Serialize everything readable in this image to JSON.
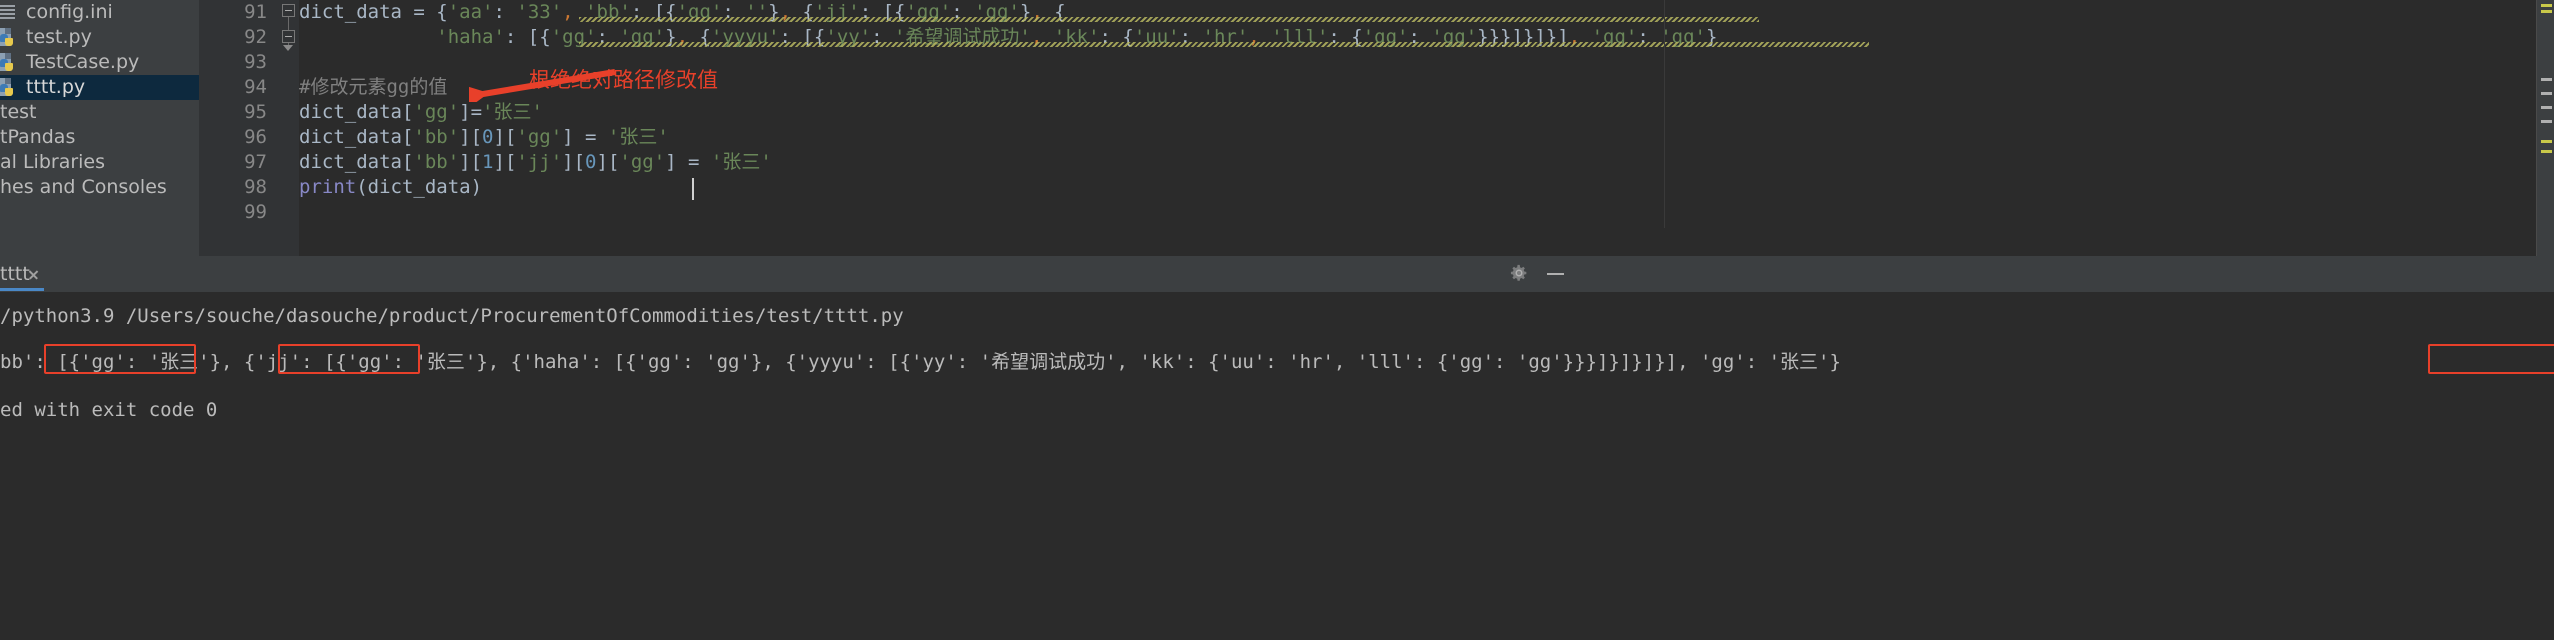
{
  "window": {
    "theme": "darcula"
  },
  "sidebar": {
    "items": [
      {
        "label": "config.ini",
        "icon": "ini-file-icon",
        "selected": false
      },
      {
        "label": "test.py",
        "icon": "python-file-icon",
        "selected": false
      },
      {
        "label": "TestCase.py",
        "icon": "python-file-icon",
        "selected": false
      },
      {
        "label": "tttt.py",
        "icon": "python-file-icon",
        "selected": true
      },
      {
        "label": "test",
        "icon": "none",
        "selected": false
      },
      {
        "label": "tPandas",
        "icon": "none",
        "selected": false
      },
      {
        "label": "al Libraries",
        "icon": "none",
        "selected": false
      },
      {
        "label": "hes and Consoles",
        "icon": "none",
        "selected": false
      }
    ]
  },
  "editor": {
    "line_numbers": [
      "91",
      "92",
      "93",
      "94",
      "95",
      "96",
      "97",
      "98",
      "99"
    ],
    "lines": [
      {
        "n": "91",
        "segments": [
          {
            "t": "dict_data = ",
            "c": "tok-def"
          },
          {
            "t": "{",
            "c": "tok-punct"
          },
          {
            "t": "'aa'",
            "c": "tok-str"
          },
          {
            "t": ": ",
            "c": "tok-punct"
          },
          {
            "t": "'33'",
            "c": "tok-str"
          },
          {
            "t": ",",
            "c": "tok-comma"
          },
          {
            "t": " ",
            "c": "tok-def"
          },
          {
            "t": "'bb'",
            "c": "tok-str"
          },
          {
            "t": ": [{",
            "c": "tok-punct"
          },
          {
            "t": "'gg'",
            "c": "tok-str"
          },
          {
            "t": ": ",
            "c": "tok-punct"
          },
          {
            "t": "''",
            "c": "tok-str"
          },
          {
            "t": "}",
            "c": "tok-punct"
          },
          {
            "t": ",",
            "c": "tok-comma"
          },
          {
            "t": " {",
            "c": "tok-punct"
          },
          {
            "t": "'jj'",
            "c": "tok-str"
          },
          {
            "t": ": [{",
            "c": "tok-punct"
          },
          {
            "t": "'gg'",
            "c": "tok-str"
          },
          {
            "t": ": ",
            "c": "tok-punct"
          },
          {
            "t": "'gg'",
            "c": "tok-str"
          },
          {
            "t": "}",
            "c": "tok-punct"
          },
          {
            "t": ",",
            "c": "tok-comma"
          },
          {
            "t": " {",
            "c": "tok-punct"
          }
        ]
      },
      {
        "n": "92",
        "segments": [
          {
            "t": "            ",
            "c": "tok-def"
          },
          {
            "t": "'haha'",
            "c": "tok-str"
          },
          {
            "t": ": [{",
            "c": "tok-punct"
          },
          {
            "t": "'gg'",
            "c": "tok-str"
          },
          {
            "t": ": ",
            "c": "tok-punct"
          },
          {
            "t": "'gg'",
            "c": "tok-str"
          },
          {
            "t": "}",
            "c": "tok-punct"
          },
          {
            "t": ",",
            "c": "tok-comma"
          },
          {
            "t": " {",
            "c": "tok-punct"
          },
          {
            "t": "'yyyu'",
            "c": "tok-str"
          },
          {
            "t": ": [{",
            "c": "tok-punct"
          },
          {
            "t": "'yy'",
            "c": "tok-str"
          },
          {
            "t": ": ",
            "c": "tok-punct"
          },
          {
            "t": "'希望调试成功'",
            "c": "tok-str"
          },
          {
            "t": ",",
            "c": "tok-comma"
          },
          {
            "t": " ",
            "c": "tok-def"
          },
          {
            "t": "'kk'",
            "c": "tok-str"
          },
          {
            "t": ": {",
            "c": "tok-punct"
          },
          {
            "t": "'uu'",
            "c": "tok-str"
          },
          {
            "t": ": ",
            "c": "tok-punct"
          },
          {
            "t": "'hr'",
            "c": "tok-str"
          },
          {
            "t": ",",
            "c": "tok-comma"
          },
          {
            "t": " ",
            "c": "tok-def"
          },
          {
            "t": "'lll'",
            "c": "tok-str"
          },
          {
            "t": ": {",
            "c": "tok-punct"
          },
          {
            "t": "'gg'",
            "c": "tok-str"
          },
          {
            "t": ": ",
            "c": "tok-punct"
          },
          {
            "t": "'gg'",
            "c": "tok-str"
          },
          {
            "t": "}}}]}]}]",
            "c": "tok-punct"
          },
          {
            "t": ",",
            "c": "tok-comma"
          },
          {
            "t": " ",
            "c": "tok-def"
          },
          {
            "t": "'gg'",
            "c": "tok-str"
          },
          {
            "t": ": ",
            "c": "tok-punct"
          },
          {
            "t": "'gg'",
            "c": "tok-str"
          },
          {
            "t": "}",
            "c": "tok-punct"
          }
        ]
      },
      {
        "n": "93",
        "segments": []
      },
      {
        "n": "94",
        "segments": [
          {
            "t": "#修改元素gg的值",
            "c": "tok-cmt"
          }
        ]
      },
      {
        "n": "95",
        "segments": [
          {
            "t": "dict_data[",
            "c": "tok-def"
          },
          {
            "t": "'gg'",
            "c": "tok-str"
          },
          {
            "t": "]=",
            "c": "tok-def"
          },
          {
            "t": "'张三'",
            "c": "tok-str"
          }
        ]
      },
      {
        "n": "96",
        "segments": [
          {
            "t": "dict_data[",
            "c": "tok-def"
          },
          {
            "t": "'bb'",
            "c": "tok-str"
          },
          {
            "t": "][",
            "c": "tok-def"
          },
          {
            "t": "0",
            "c": "tok-num"
          },
          {
            "t": "][",
            "c": "tok-def"
          },
          {
            "t": "'gg'",
            "c": "tok-str"
          },
          {
            "t": "] = ",
            "c": "tok-def"
          },
          {
            "t": "'张三'",
            "c": "tok-str"
          }
        ]
      },
      {
        "n": "97",
        "segments": [
          {
            "t": "dict_data[",
            "c": "tok-def"
          },
          {
            "t": "'bb'",
            "c": "tok-str"
          },
          {
            "t": "][",
            "c": "tok-def"
          },
          {
            "t": "1",
            "c": "tok-num"
          },
          {
            "t": "][",
            "c": "tok-def"
          },
          {
            "t": "'jj'",
            "c": "tok-str"
          },
          {
            "t": "][",
            "c": "tok-def"
          },
          {
            "t": "0",
            "c": "tok-num"
          },
          {
            "t": "][",
            "c": "tok-def"
          },
          {
            "t": "'gg'",
            "c": "tok-str"
          },
          {
            "t": "] = ",
            "c": "tok-def"
          },
          {
            "t": "'张三'",
            "c": "tok-str"
          }
        ]
      },
      {
        "n": "98",
        "segments": [
          {
            "t": "print",
            "c": "tok-fn"
          },
          {
            "t": "(dict_data)",
            "c": "tok-def"
          }
        ]
      },
      {
        "n": "99",
        "segments": []
      }
    ],
    "annotation": {
      "text": "根绝绝对路径修改值",
      "color": "#e8402a",
      "arrow": "red-arrow-pointing-left"
    }
  },
  "run_window": {
    "tab_label": "tttt",
    "close_icon": "close-icon",
    "settings_icon": "gear-icon",
    "minimize_icon": "minimize-icon",
    "console_lines": [
      "/python3.9 /Users/souche/dasouche/product/ProcurementOfCommodities/test/tttt.py",
      "bb': [{'gg': '张三'}, {'jj': [{'gg': '张三'}, {'haha': [{'gg': 'gg'}, {'yyyu': [{'yy': '希望调试成功', 'kk': {'uu': 'hr', 'lll': {'gg': 'gg'}}}]}]}]}], 'gg': '张三'}",
      "ed with exit code 0"
    ],
    "highlight_color": "#e8402a",
    "highlights": [
      "{'gg': '张三'}",
      "{'gg': '张三'}",
      "'gg': '张三'"
    ]
  },
  "colors": {
    "editor_bg": "#2b2b2b",
    "panel_bg": "#3c3f41",
    "gutter_bg": "#313335",
    "selection_bg": "#0d293e",
    "string": "#6a8759",
    "number": "#6897bb",
    "comment": "#808080",
    "function": "#8888c6",
    "default_text": "#a9b7c6",
    "tab_accent": "#4a88c7",
    "annotation_red": "#e8402a"
  }
}
